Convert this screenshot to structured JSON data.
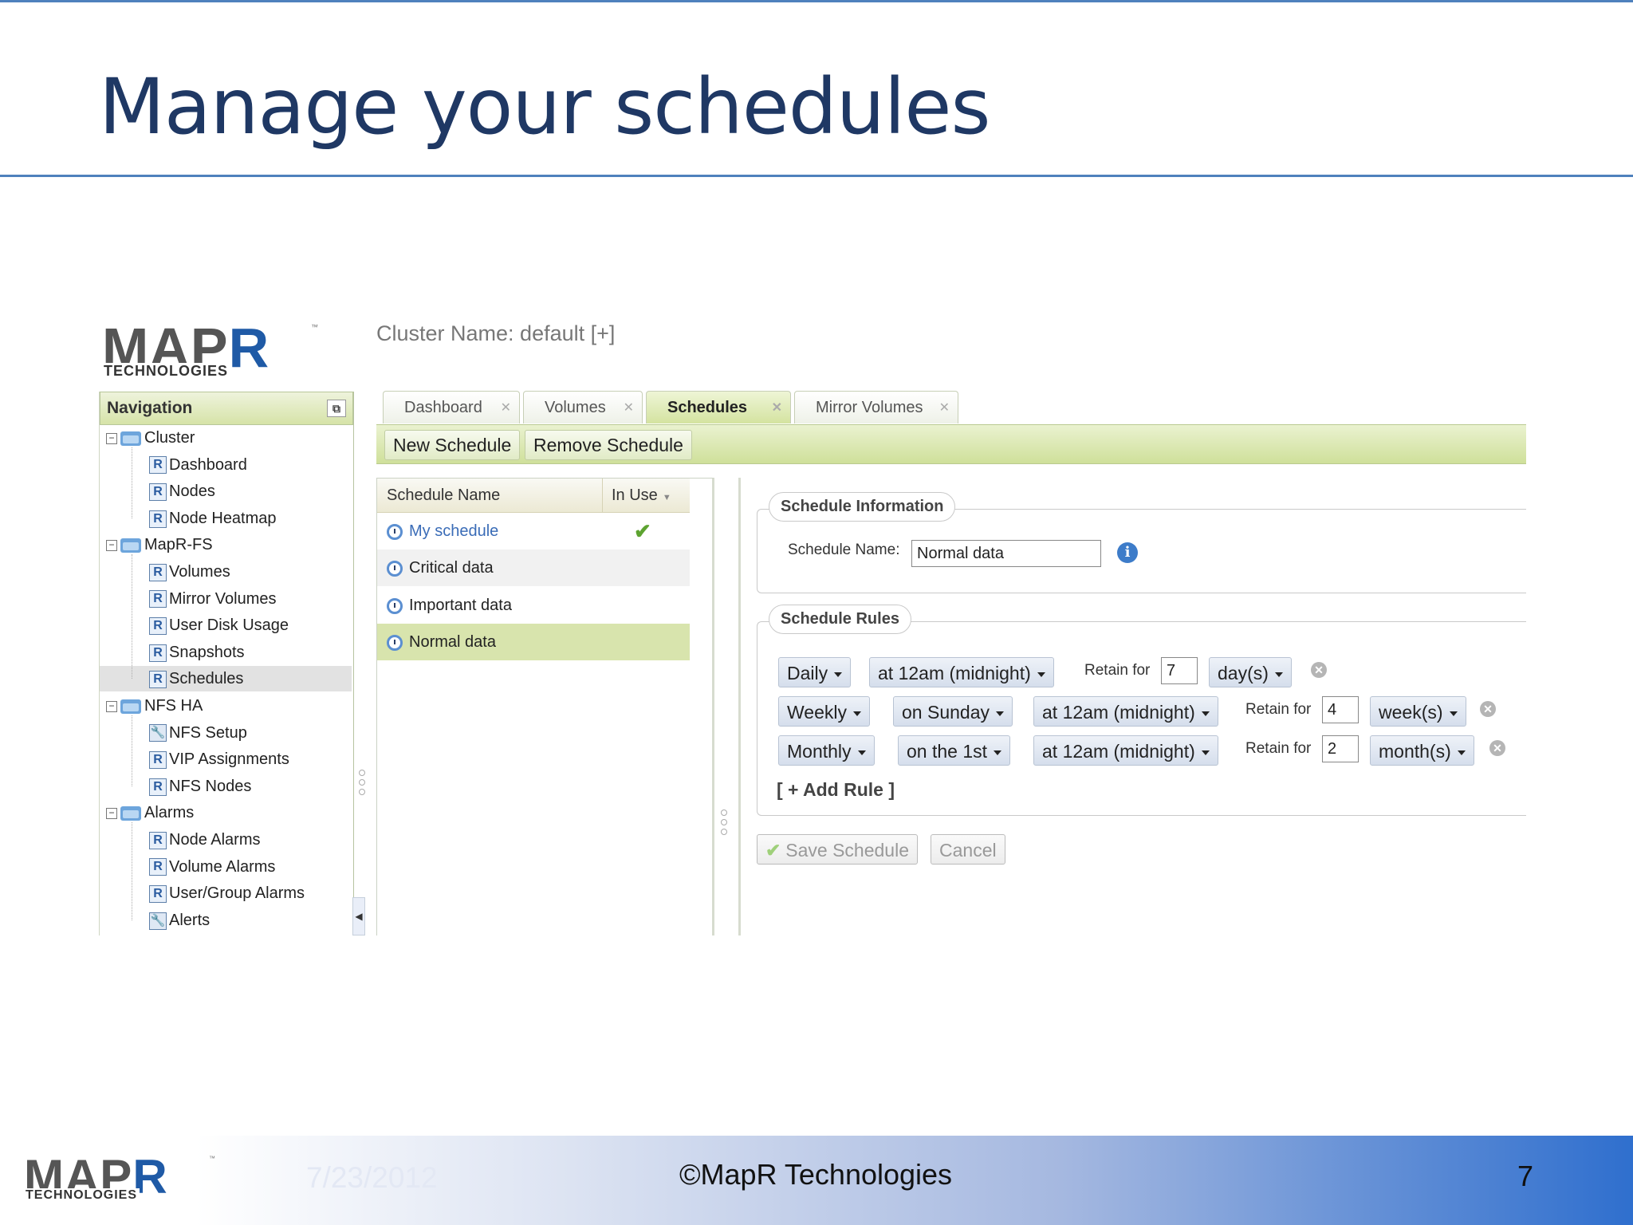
{
  "slide": {
    "title": "Manage your schedules",
    "footer_date": "7/23/2012",
    "footer_copyright": "©MapR Technologies",
    "page_number": "7",
    "logo_main": "MAP",
    "logo_r": "R",
    "logo_sub": "TECHNOLOGIES",
    "logo_tm": "™"
  },
  "app": {
    "cluster_name": "Cluster Name: default [+]",
    "navigation": {
      "header": "Navigation",
      "items": [
        {
          "label": "Cluster",
          "level": 0,
          "icon": "folder-icon"
        },
        {
          "label": "Dashboard",
          "level": 1,
          "icon": "r-icon"
        },
        {
          "label": "Nodes",
          "level": 1,
          "icon": "r-icon"
        },
        {
          "label": "Node Heatmap",
          "level": 1,
          "icon": "r-icon"
        },
        {
          "label": "MapR-FS",
          "level": 0,
          "icon": "folder-icon"
        },
        {
          "label": "Volumes",
          "level": 1,
          "icon": "r-icon"
        },
        {
          "label": "Mirror Volumes",
          "level": 1,
          "icon": "r-icon"
        },
        {
          "label": "User Disk Usage",
          "level": 1,
          "icon": "r-icon"
        },
        {
          "label": "Snapshots",
          "level": 1,
          "icon": "r-icon"
        },
        {
          "label": "Schedules",
          "level": 1,
          "icon": "r-icon",
          "selected": true
        },
        {
          "label": "NFS HA",
          "level": 0,
          "icon": "folder-icon"
        },
        {
          "label": "NFS Setup",
          "level": 1,
          "icon": "wrench-icon"
        },
        {
          "label": "VIP Assignments",
          "level": 1,
          "icon": "r-icon"
        },
        {
          "label": "NFS Nodes",
          "level": 1,
          "icon": "r-icon"
        },
        {
          "label": "Alarms",
          "level": 0,
          "icon": "folder-icon"
        },
        {
          "label": "Node Alarms",
          "level": 1,
          "icon": "r-icon"
        },
        {
          "label": "Volume Alarms",
          "level": 1,
          "icon": "r-icon"
        },
        {
          "label": "User/Group Alarms",
          "level": 1,
          "icon": "r-icon"
        },
        {
          "label": "Alerts",
          "level": 1,
          "icon": "wrench-icon"
        }
      ]
    },
    "tabs": [
      {
        "label": "Dashboard",
        "active": false
      },
      {
        "label": "Volumes",
        "active": false
      },
      {
        "label": "Schedules",
        "active": true
      },
      {
        "label": "Mirror Volumes",
        "active": false
      }
    ],
    "toolbar": {
      "new_schedule": "New Schedule",
      "remove_schedule": "Remove Schedule"
    },
    "schedule_list": {
      "col_name": "Schedule Name",
      "col_in_use": "In Use",
      "rows": [
        {
          "name": "My schedule",
          "in_use": true
        },
        {
          "name": "Critical data",
          "in_use": false
        },
        {
          "name": "Important data",
          "in_use": false
        },
        {
          "name": "Normal data",
          "in_use": false,
          "selected": true
        }
      ]
    },
    "schedule_info": {
      "legend": "Schedule Information",
      "name_label": "Schedule Name:",
      "name_value": "Normal data",
      "info_glyph": "i"
    },
    "schedule_rules": {
      "legend": "Schedule Rules",
      "retain_label": "Retain for",
      "rules": [
        {
          "frequency": "Daily",
          "day": "",
          "time": "at 12am (midnight)",
          "retain": "7",
          "unit": "day(s)"
        },
        {
          "frequency": "Weekly",
          "day": "on Sunday",
          "time": "at 12am (midnight)",
          "retain": "4",
          "unit": "week(s)"
        },
        {
          "frequency": "Monthly",
          "day": "on the 1st",
          "time": "at 12am (midnight)",
          "retain": "2",
          "unit": "month(s)"
        }
      ],
      "add_rule": "[ + Add Rule ]"
    },
    "actions": {
      "save": "Save Schedule",
      "cancel": "Cancel"
    }
  }
}
